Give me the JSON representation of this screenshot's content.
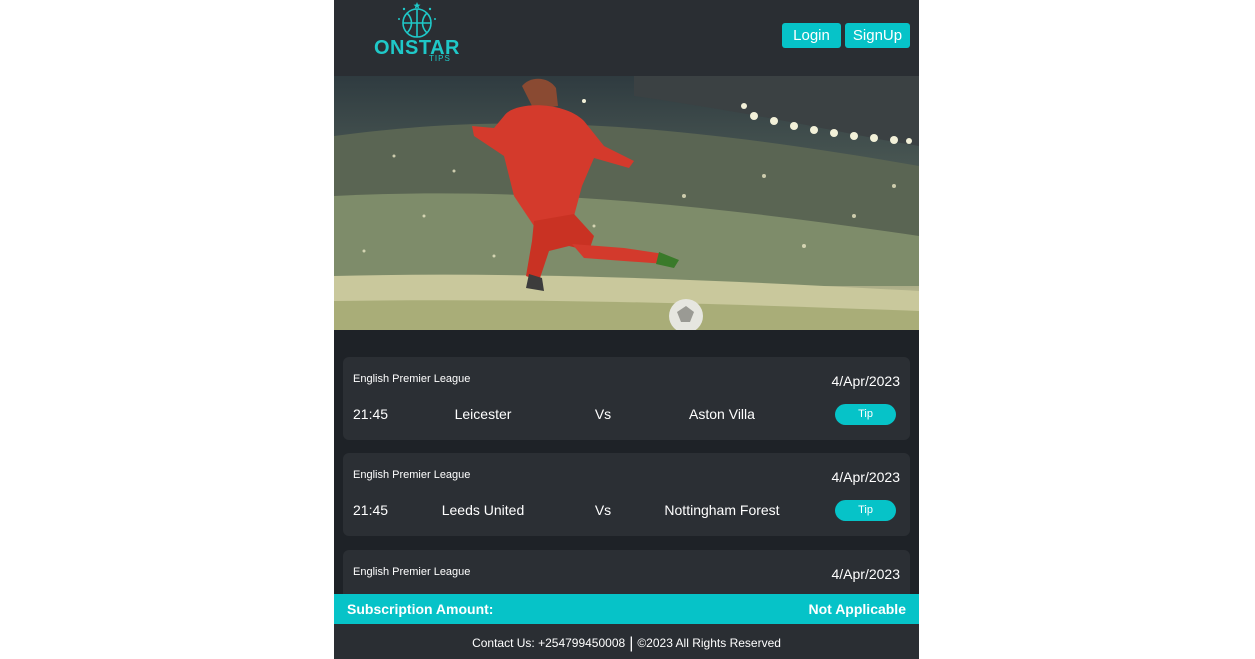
{
  "brand": {
    "name": "ONSTAR",
    "sub": "TIPS",
    "accent_color": "#06c3c8"
  },
  "header": {
    "login_label": "Login",
    "signup_label": "SignUp"
  },
  "matches": [
    {
      "league": "English Premier League",
      "date": "4/Apr/2023",
      "time": "21:45",
      "home": "Leicester",
      "vs": "Vs",
      "away": "Aston Villa",
      "tip_label": "Tip"
    },
    {
      "league": "English Premier League",
      "date": "4/Apr/2023",
      "time": "21:45",
      "home": "Leeds United",
      "vs": "Vs",
      "away": "Nottingham Forest",
      "tip_label": "Tip"
    },
    {
      "league": "English Premier League",
      "date": "4/Apr/2023",
      "time": "",
      "home": "",
      "vs": "",
      "away": "",
      "tip_label": ""
    }
  ],
  "subscription": {
    "label": "Subscription Amount:",
    "value": "Not Applicable"
  },
  "footer": {
    "contact": "Contact Us: +254799450008",
    "separator": "|",
    "copyright": "©2023 All Rights Reserved"
  }
}
